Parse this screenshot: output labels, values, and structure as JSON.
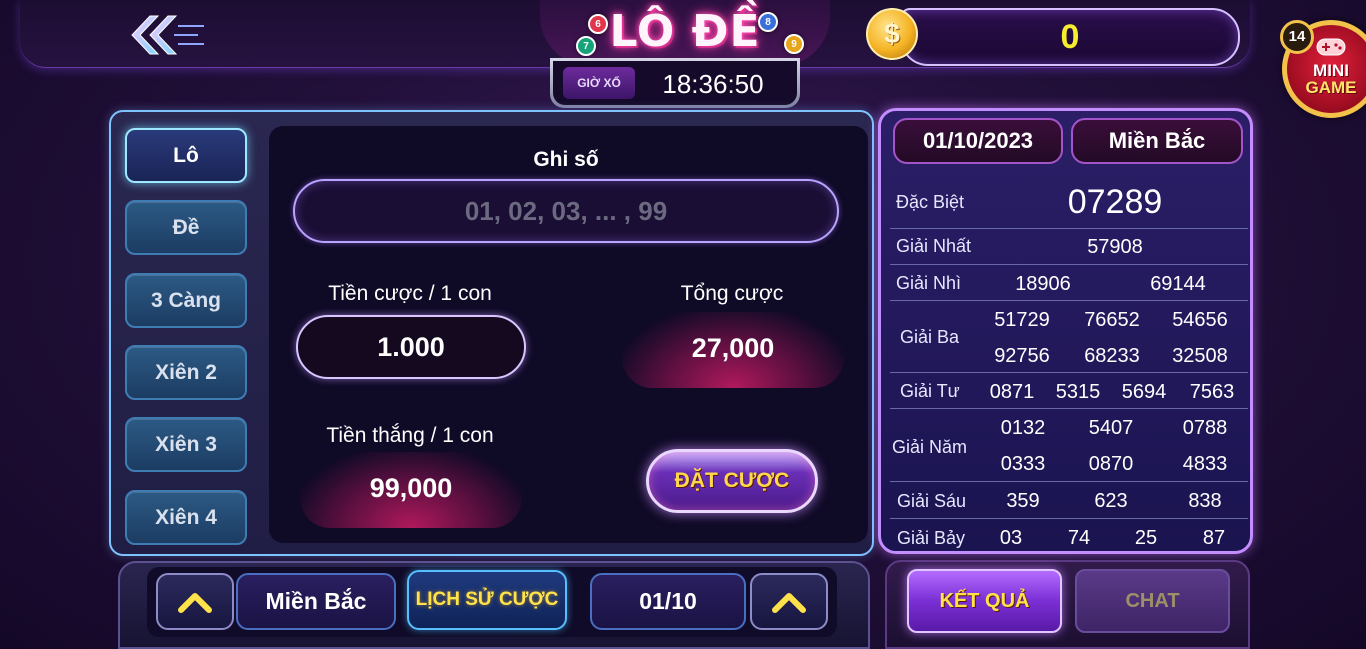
{
  "header": {
    "title": "LÔ ĐỀ",
    "ball_numbers": [
      "6",
      "8",
      "7",
      "9"
    ],
    "timer_label": "GIỜ XỔ",
    "timer_value": "18:36:50",
    "balance": "0",
    "coin_symbol": "$",
    "mini_game": {
      "badge": "14",
      "line1": "MINI",
      "line2": "GAME"
    }
  },
  "tabs": [
    "Lô",
    "Đề",
    "3 Càng",
    "Xiên 2",
    "Xiên 3",
    "Xiên 4"
  ],
  "active_tab": "Lô",
  "bet_form": {
    "number_label": "Ghi số",
    "number_placeholder": "01, 02, 03, ... , 99",
    "stake_label": "Tiền cược / 1 con",
    "stake_value": "1.000",
    "total_label": "Tổng cược",
    "total_value": "27,000",
    "win_label": "Tiền thắng / 1 con",
    "win_value": "99,000",
    "bet_button": "ĐẶT CƯỢC"
  },
  "results": {
    "date": "01/10/2023",
    "region": "Miền Bắc",
    "special": {
      "label": "Đặc Biệt",
      "values": [
        "07289"
      ]
    },
    "first": {
      "label": "Giải Nhất",
      "values": [
        "57908"
      ]
    },
    "second": {
      "label": "Giải Nhì",
      "values": [
        "18906",
        "69144"
      ]
    },
    "third": {
      "label": "Giải Ba",
      "values": [
        "51729",
        "76652",
        "54656",
        "92756",
        "68233",
        "32508"
      ]
    },
    "fourth": {
      "label": "Giải Tư",
      "values": [
        "0871",
        "5315",
        "5694",
        "7563"
      ]
    },
    "fifth": {
      "label": "Giải Năm",
      "values": [
        "0132",
        "5407",
        "0788",
        "0333",
        "0870",
        "4833"
      ]
    },
    "sixth": {
      "label": "Giải Sáu",
      "values": [
        "359",
        "623",
        "838"
      ]
    },
    "seventh": {
      "label": "Giải Bảy",
      "values": [
        "03",
        "74",
        "25",
        "87"
      ]
    }
  },
  "bottom": {
    "region": "Miền Bắc",
    "history_button": "LỊCH SỬ CƯỢC",
    "date": "01/10",
    "result_tab": "KẾT QUẢ",
    "chat_tab": "CHAT"
  },
  "colors": {
    "accent_yellow": "#ffe34a",
    "balance_yellow": "#f6ee2a",
    "tab_active_border": "#9ee8ff",
    "results_border": "#c38cff"
  }
}
